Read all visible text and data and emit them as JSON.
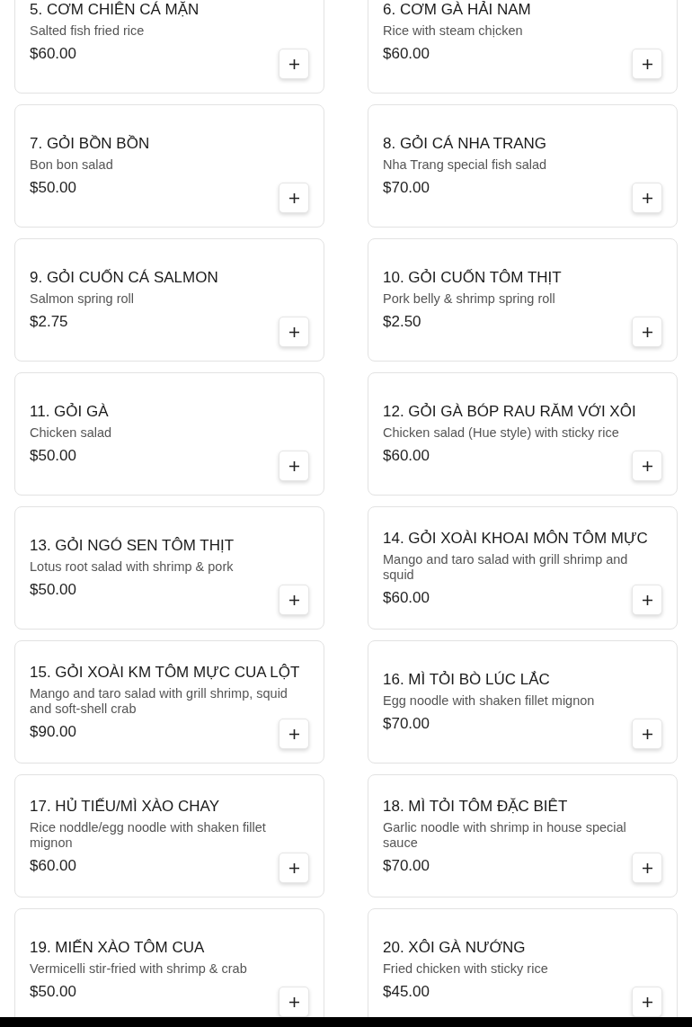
{
  "items": [
    {
      "name": "5. CƠM CHIÊN CÁ MẶN",
      "description": "Salted fish fried rice",
      "price": "$60.00"
    },
    {
      "name": "6. CƠM GÀ HẢI NAM",
      "description": "Rice with steam chịcken",
      "price": "$60.00"
    },
    {
      "name": "7. GỎI BỒN BỒN",
      "description": "Bon bon salad",
      "price": "$50.00"
    },
    {
      "name": "8. GỎI CÁ NHA TRANG",
      "description": "Nha Trang special fish salad",
      "price": "$70.00"
    },
    {
      "name": "9. GỎI CUỐN CÁ SALMON",
      "description": "Salmon spring roll",
      "price": "$2.75"
    },
    {
      "name": "10. GỎI CUỐN TÔM THỊT",
      "description": "Pork belly & shrimp spring roll",
      "price": "$2.50"
    },
    {
      "name": "11. GỎI GÀ",
      "description": "Chicken salad",
      "price": "$50.00"
    },
    {
      "name": "12. GỎI GÀ BÓP RAU RĂM VỚI XÔI",
      "description": "Chicken salad (Hue style) with sticky rice",
      "price": "$60.00"
    },
    {
      "name": "13. GỎI NGÓ SEN TÔM THỊT",
      "description": "Lotus root salad with shrimp & pork",
      "price": "$50.00"
    },
    {
      "name": "14. GỎI XOÀI KHOAI MÔN TÔM MỰC",
      "description": "Mango and taro salad with grill shrimp and squid",
      "price": "$60.00"
    },
    {
      "name": "15. GỎI XOÀI KM TÔM MỰC CUA LỘT",
      "description": "Mango and taro salad with grill shrimp, squid and soft-shell crab",
      "price": "$90.00"
    },
    {
      "name": "16. MÌ TỎI BÒ LÚC LẮC",
      "description": "Egg noodle with shaken fillet mignon",
      "price": "$70.00"
    },
    {
      "name": "17. HỦ TIẾU/MÌ XÀO CHAY",
      "description": "Rice noddle/egg noodle with shaken fillet mignon",
      "price": "$60.00"
    },
    {
      "name": "18. MÌ TỎI TÔM ĐẶC BIÊT",
      "description": "Garlic noodle with shrimp in house special sauce",
      "price": "$70.00"
    },
    {
      "name": "19. MIẾN XÀO TÔM CUA",
      "description": "Vermicelli stir-fried with shrimp & crab",
      "price": "$50.00"
    },
    {
      "name": "20. XÔI GÀ NƯỚNG",
      "description": "Fried chicken with sticky rice",
      "price": "$45.00"
    }
  ]
}
